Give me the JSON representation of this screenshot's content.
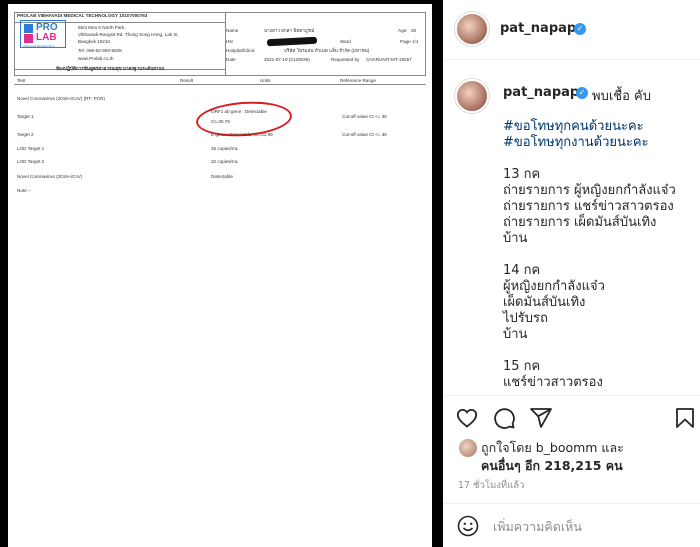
{
  "document": {
    "lab_name": "PROLAB VIBHAVADI MEDICAL TECHNOLOGY 10107000763",
    "address": [
      "55/3 Moo 5 North Park,",
      "Vibhavadi-Rangsit Rd. Thung Song Hong, Lak Si,",
      "Bangkok 10210",
      "Tel. 066-62-993-9208",
      "www.Prolab.co.th"
    ],
    "cert_line": "ห้องปฏิบัติการชันสูตรสาธารณสุข มาตรฐานระดับสากล",
    "logo_top": "PRO",
    "logo_bottom": "LAB",
    "logo_sub": "Vibhavadi Medical Tech",
    "fields": {
      "name_label": "Name",
      "name_value": "นางสาว ผกสา พิทยาบูรณ์",
      "age_label": "Age:",
      "age_value": "26",
      "hn_label": "HN",
      "ward_label": "Ward",
      "page_label": "Page 1/1",
      "hospital_label": "Hospital/Clinic",
      "hospital_value": "บริษัท โพรแลบ หัวเมด แล็บ จำกัด (มหาชน)",
      "date_label": "Date",
      "date_value": "2021-07-19 (2120039) ",
      "requested_label": "Requested by",
      "requested_value": "CHARUNIT-MT-19257"
    },
    "columns": [
      "Test",
      "Result",
      "Units",
      "Reference Range"
    ],
    "rows": [
      {
        "test": "Novel Coronavirus (2019-nCoV) (RT- PCR)",
        "result": "",
        "ref": ""
      },
      {
        "test": "Target 1",
        "result": "ORF1 ab gene : Detectable",
        "result2": "Ct=30.79",
        "ref": "Cut-off value Ct <= 36"
      },
      {
        "test": "Target 2",
        "result": "E gene : Detectable, Ct=31.99",
        "ref": "Cut-off value Ct <= 36"
      },
      {
        "test": "LOD Target 1",
        "result": "25 copies/mL",
        "ref": ""
      },
      {
        "test": "LOD Target 2",
        "result": "32 copies/mL",
        "ref": ""
      },
      {
        "test": "Novel Coronavirus (2019-nCoV)",
        "result": "Detectable",
        "ref": ""
      },
      {
        "test": "Note :-",
        "result": "",
        "ref": ""
      }
    ]
  },
  "header": {
    "username": "pat_napapa",
    "verified": "✓"
  },
  "caption": {
    "username": "pat_napapa",
    "first_text": "พบเชื้อ คับ",
    "lines": [
      {
        "text": "#ขอโทษทุกคนด้วยนะคะ",
        "tag": true
      },
      {
        "text": "#ขอโทษทุกงานด้วยนะคะ",
        "tag": true
      },
      {
        "text": "",
        "tag": false
      },
      {
        "text": "13 กค",
        "tag": false
      },
      {
        "text": "ถ่ายรายการ ผู้หญิงยกกำลังแจ๋ว",
        "tag": false
      },
      {
        "text": "ถ่ายรายการ แชร์ข่าวสาวตรอง",
        "tag": false
      },
      {
        "text": "ถ่ายรายการ เผ็ดมันส์บันเทิง",
        "tag": false
      },
      {
        "text": "บ้าน",
        "tag": false
      },
      {
        "text": "",
        "tag": false
      },
      {
        "text": "14 กค",
        "tag": false
      },
      {
        "text": "ผู้หญิงยกกำลังแจ๋ว",
        "tag": false
      },
      {
        "text": "เผ็ดมันส์บันเทิง",
        "tag": false
      },
      {
        "text": "ไปรับรถ",
        "tag": false
      },
      {
        "text": "บ้าน",
        "tag": false
      },
      {
        "text": "",
        "tag": false
      },
      {
        "text": "15 กค",
        "tag": false
      },
      {
        "text": "แชร์ข่าวสาวตรอง",
        "tag": false
      }
    ]
  },
  "likes": {
    "line1": "ถูกใจโดย b_boomm และ",
    "line2": "คนอื่นๆ อีก 218,215 คน"
  },
  "time": "17 ชั่วโมงที่แล้ว",
  "comment": {
    "placeholder": "เพิ่มความคิดเห็น"
  },
  "icons": [
    "heart-icon",
    "comment-icon",
    "share-icon",
    "bookmark-icon",
    "emoji-icon",
    "verified-icon"
  ],
  "colors": {
    "hashtag": "#00376b",
    "verified": "#3897f0",
    "circle": "#d62020"
  }
}
